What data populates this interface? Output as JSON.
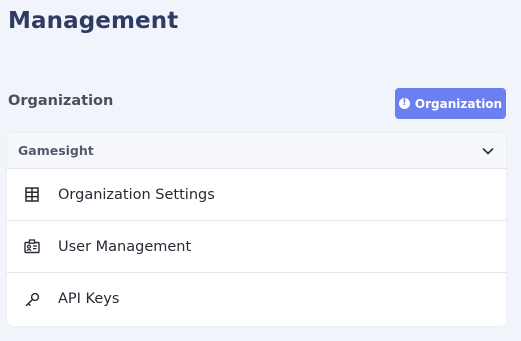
{
  "page": {
    "title": "Management"
  },
  "section": {
    "title": "Organization"
  },
  "org_button": {
    "label": "Organization",
    "icon": "info-icon",
    "color": "#6c7ff0"
  },
  "org_card": {
    "selected_org": "Gamesight",
    "chevron_icon": "chevron-down-icon",
    "items": [
      {
        "label": "Organization Settings",
        "icon": "building-icon"
      },
      {
        "label": "User Management",
        "icon": "id-card-icon"
      },
      {
        "label": "API Keys",
        "icon": "key-icon"
      }
    ]
  }
}
